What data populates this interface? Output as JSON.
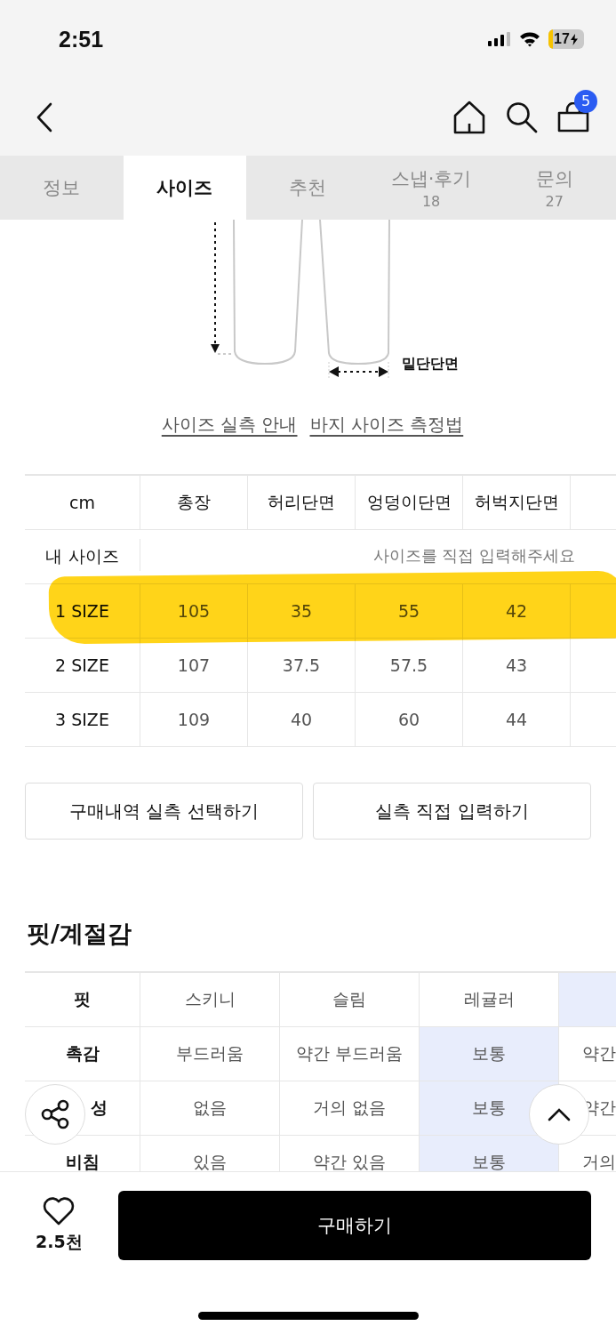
{
  "status_bar": {
    "time": "2:51",
    "battery": "17"
  },
  "nav": {
    "cart_count": "5"
  },
  "tabs": [
    {
      "label": "정보",
      "selected": false
    },
    {
      "label": "사이즈",
      "selected": true
    },
    {
      "label": "추천",
      "selected": false
    },
    {
      "label": "스냅·후기",
      "count": "18",
      "selected": false
    },
    {
      "label": "문의",
      "count": "27",
      "selected": false
    }
  ],
  "diagram": {
    "label": "밑단단면"
  },
  "links": [
    "사이즈 실측 안내",
    "바지 사이즈 측정법"
  ],
  "size_table": {
    "columns": [
      "cm",
      "총장",
      "허리단면",
      "엉덩이단면",
      "허벅지단면"
    ],
    "my_size": {
      "label": "내 사이즈",
      "placeholder": "사이즈를 직접 입력해주세요"
    },
    "rows": [
      {
        "label": "1 SIZE",
        "values": [
          "105",
          "35",
          "55",
          "42"
        ],
        "highlighted": true
      },
      {
        "label": "2 SIZE",
        "values": [
          "107",
          "37.5",
          "57.5",
          "43"
        ],
        "highlighted": false
      },
      {
        "label": "3 SIZE",
        "values": [
          "109",
          "40",
          "60",
          "44"
        ],
        "highlighted": false
      }
    ]
  },
  "buttons": [
    "구매내역 실측 선택하기",
    "실측 직접 입력하기"
  ],
  "fit": {
    "title": "핏/계절감",
    "rows": [
      {
        "label": "핏",
        "options": [
          {
            "text": "스키니",
            "selected": false
          },
          {
            "text": "슬림",
            "selected": false
          },
          {
            "text": "레귤러",
            "selected": false
          },
          {
            "selected": true
          }
        ]
      },
      {
        "label": "촉감",
        "options": [
          {
            "text": "부드러움",
            "selected": false
          },
          {
            "text": "약간 부드러움",
            "selected": false
          },
          {
            "text": "보통",
            "selected": true
          },
          {
            "text": "약간",
            "selected": false
          }
        ]
      },
      {
        "label": "성",
        "options": [
          {
            "text": "없음",
            "selected": false
          },
          {
            "text": "거의 없음",
            "selected": false
          },
          {
            "text": "보통",
            "selected": true
          },
          {
            "text": "약간",
            "selected": false
          }
        ]
      },
      {
        "label": "비침",
        "options": [
          {
            "text": "있음",
            "selected": false
          },
          {
            "text": "약간 있음",
            "selected": false
          },
          {
            "text": "보통",
            "selected": true
          },
          {
            "text": "거의",
            "selected": false
          }
        ]
      }
    ]
  },
  "bottom": {
    "likes": "2.5천",
    "buy": "구매하기"
  }
}
